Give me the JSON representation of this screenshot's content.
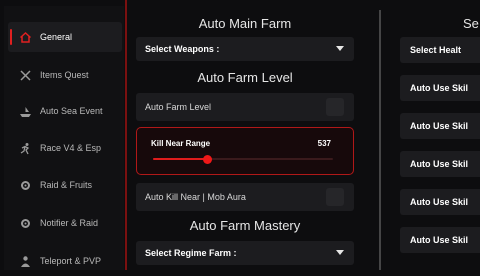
{
  "sidebar": {
    "items": [
      {
        "label": "General",
        "icon": "home-icon",
        "active": true
      },
      {
        "label": "Items Quest",
        "icon": "crossed-swords-icon",
        "active": false
      },
      {
        "label": "Auto Sea Event",
        "icon": "ship-icon",
        "active": false
      },
      {
        "label": "Race V4 & Esp",
        "icon": "running-person-icon",
        "active": false
      },
      {
        "label": "Raid & Fruits",
        "icon": "gear-icon",
        "active": false
      },
      {
        "label": "Notifier & Raid",
        "icon": "gear-icon",
        "active": false
      },
      {
        "label": "Teleport & PVP",
        "icon": "person-icon",
        "active": false
      }
    ]
  },
  "main": {
    "farm_heading": "Auto Main Farm",
    "select_weapons": "Select Weapons :",
    "level_heading": "Auto Farm Level",
    "auto_farm_level": "Auto Farm Level",
    "kill_near_range_label": "Kill Near Range",
    "kill_near_range_value": "537",
    "kill_near_range_fraction": 0.3,
    "auto_kill_near": "Auto Kill Near | Mob Aura",
    "mastery_heading": "Auto Farm Mastery",
    "select_regime": "Select Regime Farm :"
  },
  "right": {
    "heading": "Se",
    "select_heal": "Select Healt",
    "rows": [
      "Auto Use Skil",
      "Auto Use Skil",
      "Auto Use Skil",
      "Auto Use Skil",
      "Auto Use Skil"
    ]
  },
  "colors": {
    "accent": "#e01c1c",
    "background": "#0d0d0f",
    "panel": "#1c1c1f"
  }
}
